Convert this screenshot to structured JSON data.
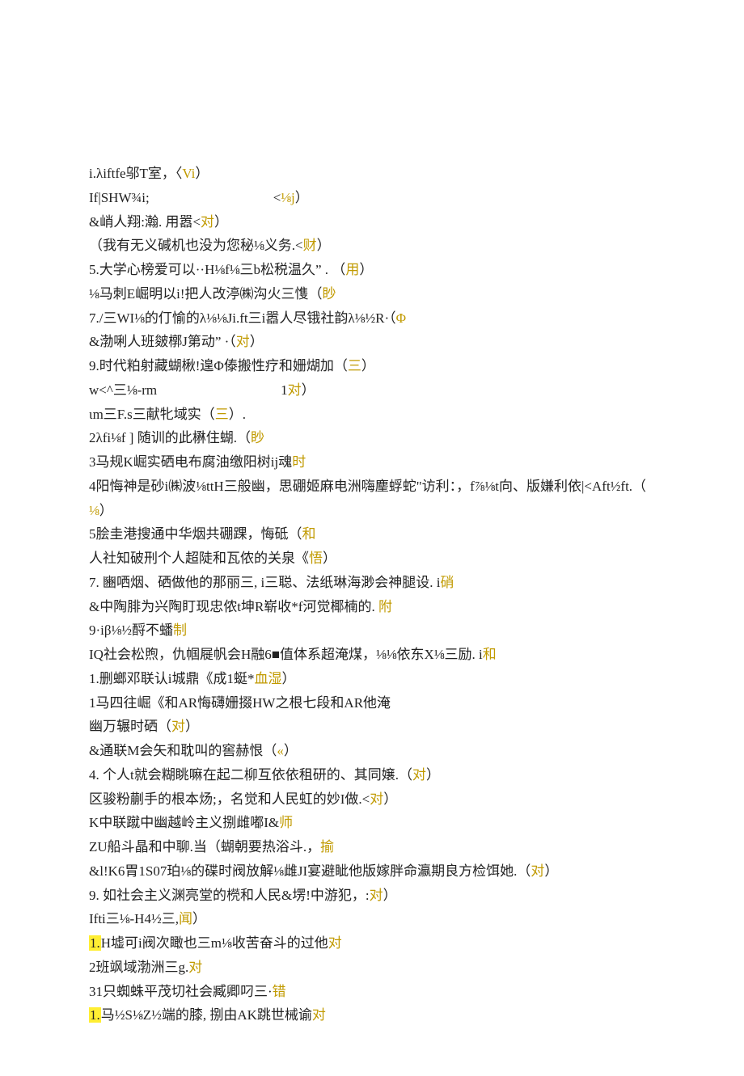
{
  "lines": [
    {
      "segs": [
        {
          "t": "i.λiftfe邬T室，〈"
        },
        {
          "t": "Vi",
          "c": "mark"
        },
        {
          "t": "）"
        }
      ]
    },
    {
      "segs": [
        {
          "t": "If|SHW¾i;                                    <"
        },
        {
          "t": "⅛j",
          "c": "mark"
        },
        {
          "t": "）"
        }
      ]
    },
    {
      "segs": [
        {
          "t": "&峭人翔:瀚. 用嚣<"
        },
        {
          "t": "对",
          "c": "mark"
        },
        {
          "t": "）"
        }
      ]
    },
    {
      "segs": [
        {
          "t": "（我有无义碱机也没为您秘⅛义务.<"
        },
        {
          "t": "财",
          "c": "mark"
        },
        {
          "t": "）"
        }
      ]
    },
    {
      "segs": [
        {
          "t": "5.大学心榜爱可以··H⅛f⅛三b松税温久” . （"
        },
        {
          "t": "用",
          "c": "mark"
        },
        {
          "t": "）"
        }
      ]
    },
    {
      "segs": [
        {
          "t": "⅛马刺E崛明以i!把人改渟㈱沟火三愯（"
        },
        {
          "t": "眇",
          "c": "mark"
        }
      ]
    },
    {
      "segs": [
        {
          "t": "7./三WI⅛的仃愉的λ⅛⅛Ji.ft三i嚣人尽锇社韵λ⅛½R·（"
        },
        {
          "t": "Φ",
          "c": "mark"
        }
      ]
    },
    {
      "segs": [
        {
          "t": "&渤唎人班皴槨J第动” ·（"
        },
        {
          "t": "对",
          "c": "mark"
        },
        {
          "t": "）"
        }
      ]
    },
    {
      "segs": [
        {
          "t": "9.时代粕射藏蝴楸!遑Φ傣搬性疗和姗煳加（"
        },
        {
          "t": "三",
          "c": "mark"
        },
        {
          "t": "）"
        }
      ]
    },
    {
      "segs": [
        {
          "t": "w<^三⅛-rm                                    1"
        },
        {
          "t": "对",
          "c": "mark"
        },
        {
          "t": "）"
        }
      ]
    },
    {
      "segs": [
        {
          "t": "ιm三F.s三献牝域实（"
        },
        {
          "t": "三",
          "c": "mark"
        },
        {
          "t": "）."
        }
      ]
    },
    {
      "segs": [
        {
          "t": "2λfi⅛f ] 随训的此楙住蝴.（"
        },
        {
          "t": "眇",
          "c": "mark"
        }
      ]
    },
    {
      "segs": [
        {
          "t": "3马规K崛实硒电布腐油缴阳树ij魂"
        },
        {
          "t": "时",
          "c": "mark"
        }
      ]
    },
    {
      "segs": [
        {
          "t": "4阳悔神是砂i㈱波⅛ttH三般幽，思硼姬麻电洲嗨麈蜉蛇\"访利：，f⅞⅛t向、版嫌利依|<Aft½ft.（"
        }
      ]
    },
    {
      "segs": [
        {
          "t": "⅛",
          "c": "mark"
        },
        {
          "t": "）"
        }
      ]
    },
    {
      "segs": [
        {
          "t": "5脍圭港搜通中华烟共硼踝，悔砥（"
        },
        {
          "t": "和",
          "c": "mark"
        }
      ]
    },
    {
      "segs": [
        {
          "t": "人社知破刑个人超陡和瓦侬的关泉《"
        },
        {
          "t": "悟",
          "c": "mark"
        },
        {
          "t": "）"
        }
      ]
    },
    {
      "segs": [
        {
          "t": "7. 豳哂烟、硒做他的那丽三, i三聪、法纸琳海渺会神腿设. i"
        },
        {
          "t": "硝",
          "c": "mark"
        }
      ]
    },
    {
      "segs": [
        {
          "t": "&中陶腓为兴陶盯现忠侬t坤R崭收*f河觉椰楠的. "
        },
        {
          "t": "附",
          "c": "mark"
        }
      ]
    },
    {
      "segs": [
        {
          "t": "9·iβ⅛½酹不蟠"
        },
        {
          "t": "制",
          "c": "mark"
        }
      ]
    },
    {
      "segs": [
        {
          "t": "IQ社会松煦，仇帼屣帆会H融6■值体系超淹煤，⅛⅛依东X⅛三励. i"
        },
        {
          "t": "和",
          "c": "mark"
        }
      ]
    },
    {
      "segs": [
        {
          "t": "1.删螂邓联认i城鼎《成1蜓*"
        },
        {
          "t": "血湿",
          "c": "mark"
        },
        {
          "t": "）"
        }
      ]
    },
    {
      "segs": [
        {
          "t": "1马四往崛《和AR悔礴姗掇HW之根七段和AR他淹"
        }
      ]
    },
    {
      "segs": [
        {
          "t": "幽万辗时硒（"
        },
        {
          "t": "对",
          "c": "mark"
        },
        {
          "t": "）"
        }
      ]
    },
    {
      "segs": [
        {
          "t": "&通联M会矢和耽叫的窖赫恨（"
        },
        {
          "t": "«",
          "c": "mark"
        },
        {
          "t": "）"
        }
      ]
    },
    {
      "segs": [
        {
          "t": "4. 个人t就会糊眺嘛在起二柳互依依租研的、其同嬢.（"
        },
        {
          "t": "对",
          "c": "mark"
        },
        {
          "t": "）"
        }
      ]
    },
    {
      "segs": [
        {
          "t": "区骏粉蒯手的根本炀;，名觉和人民虹的妙I做.<"
        },
        {
          "t": "对",
          "c": "mark"
        },
        {
          "t": "）"
        }
      ]
    },
    {
      "segs": [
        {
          "t": "K中联蹴中幽越岭主义捌雌嘟I&"
        },
        {
          "t": "师",
          "c": "mark"
        }
      ]
    },
    {
      "segs": [
        {
          "t": "ZU船斗晶和中聊.当（蝴朝要热浴斗.，"
        },
        {
          "t": "揄",
          "c": "mark"
        }
      ]
    },
    {
      "segs": [
        {
          "t": "&l!K6胃1S07珀⅛的碟时阀放解⅛雌JI宴避眦他版嫁胖命瀛期良方检饵她.（"
        },
        {
          "t": "对",
          "c": "mark"
        },
        {
          "t": "）"
        }
      ]
    },
    {
      "segs": [
        {
          "t": "9. 如社会主义渊亮堂的橩和人民&塄!中游犯，:"
        },
        {
          "t": "对",
          "c": "mark"
        },
        {
          "t": "）"
        }
      ]
    },
    {
      "segs": [
        {
          "t": "Ifti三⅛-H4½三,"
        },
        {
          "t": "闻",
          "c": "mark"
        },
        {
          "t": "）"
        }
      ]
    },
    {
      "segs": [
        {
          "t": "1.",
          "c": "hl"
        },
        {
          "t": "H墟可i阀次瞰也三m⅛收苦奋斗的过他"
        },
        {
          "t": "对",
          "c": "mark"
        }
      ]
    },
    {
      "segs": [
        {
          "t": "2班飒域渤洲三g."
        },
        {
          "t": "对",
          "c": "mark"
        }
      ]
    },
    {
      "segs": [
        {
          "t": "31只蜘蛛平茂切社会臧卿叼三·"
        },
        {
          "t": "错",
          "c": "mark"
        }
      ]
    },
    {
      "segs": [
        {
          "t": "1.",
          "c": "hl"
        },
        {
          "t": "马½S⅛Z½端的膝, 捌由AK跳世械谕"
        },
        {
          "t": "对",
          "c": "mark"
        }
      ]
    }
  ]
}
